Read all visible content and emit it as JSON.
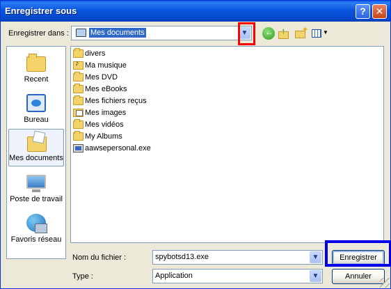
{
  "window": {
    "title": "Enregistrer sous",
    "help_button": "?",
    "close_button": "✕"
  },
  "lookin": {
    "label": "Enregistrer dans :",
    "value": "Mes documents",
    "dropdown_icon": "chevron-down-icon"
  },
  "toolbar": {
    "icons": [
      "back-icon",
      "up-folder-icon",
      "new-folder-icon",
      "view-menu-icon"
    ]
  },
  "places": [
    {
      "label": "Recent",
      "icon": "recent-folder-icon",
      "selected": false
    },
    {
      "label": "Bureau",
      "icon": "desktop-icon",
      "selected": false
    },
    {
      "label": "Mes documents",
      "icon": "my-documents-icon",
      "selected": true
    },
    {
      "label": "Poste de travail",
      "icon": "my-computer-icon",
      "selected": false
    },
    {
      "label": "Favoris réseau",
      "icon": "network-places-icon",
      "selected": false
    }
  ],
  "files": [
    {
      "name": "divers",
      "type": "folder"
    },
    {
      "name": "Ma musique",
      "type": "music-folder"
    },
    {
      "name": "Mes DVD",
      "type": "folder"
    },
    {
      "name": "Mes eBooks",
      "type": "folder"
    },
    {
      "name": "Mes fichiers reçus",
      "type": "folder"
    },
    {
      "name": "Mes images",
      "type": "images-folder"
    },
    {
      "name": "Mes vidéos",
      "type": "folder"
    },
    {
      "name": "My Albums",
      "type": "folder"
    },
    {
      "name": "aawsepersonal.exe",
      "type": "exe"
    }
  ],
  "filename": {
    "label": "Nom du fichier :",
    "value": "spybotsd13.exe"
  },
  "filetype": {
    "label": "Type :",
    "value": "Application"
  },
  "buttons": {
    "save": "Enregistrer",
    "cancel": "Annuler"
  },
  "highlight_colors": {
    "lookin_dropdown_box": "#ff0000",
    "save_button_box": "#0000e8"
  }
}
